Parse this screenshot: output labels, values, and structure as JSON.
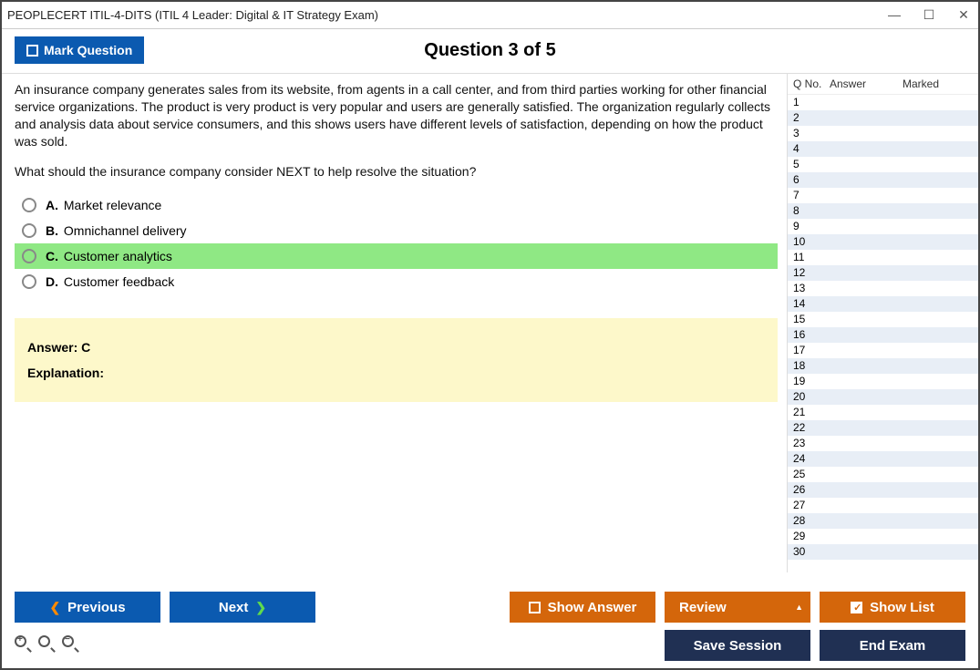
{
  "window": {
    "title": "PEOPLECERT ITIL-4-DITS (ITIL 4 Leader: Digital & IT Strategy Exam)"
  },
  "header": {
    "mark_label": "Mark Question",
    "question_heading": "Question 3 of 5"
  },
  "question": {
    "para1": "An insurance company generates sales from its website, from agents in a call center, and from third parties working for other financial service organizations. The product is very product is very popular and users are generally satisfied. The organization regularly collects and analysis data about service consumers, and this shows users have different levels of satisfaction, depending on how the product was sold.",
    "para2": "What should the insurance company consider NEXT to help resolve the situation?"
  },
  "options": {
    "a": {
      "letter": "A.",
      "text": "Market relevance"
    },
    "b": {
      "letter": "B.",
      "text": "Omnichannel delivery"
    },
    "c": {
      "letter": "C.",
      "text": "Customer analytics"
    },
    "d": {
      "letter": "D.",
      "text": "Customer feedback"
    }
  },
  "answer_box": {
    "answer_label": "Answer: C",
    "explanation_label": "Explanation:"
  },
  "list": {
    "headers": {
      "qno": "Q No.",
      "answer": "Answer",
      "marked": "Marked"
    },
    "count": 30
  },
  "buttons": {
    "previous": "Previous",
    "next": "Next",
    "show_answer": "Show Answer",
    "review": "Review",
    "show_list": "Show List",
    "save_session": "Save Session",
    "end_exam": "End Exam"
  }
}
